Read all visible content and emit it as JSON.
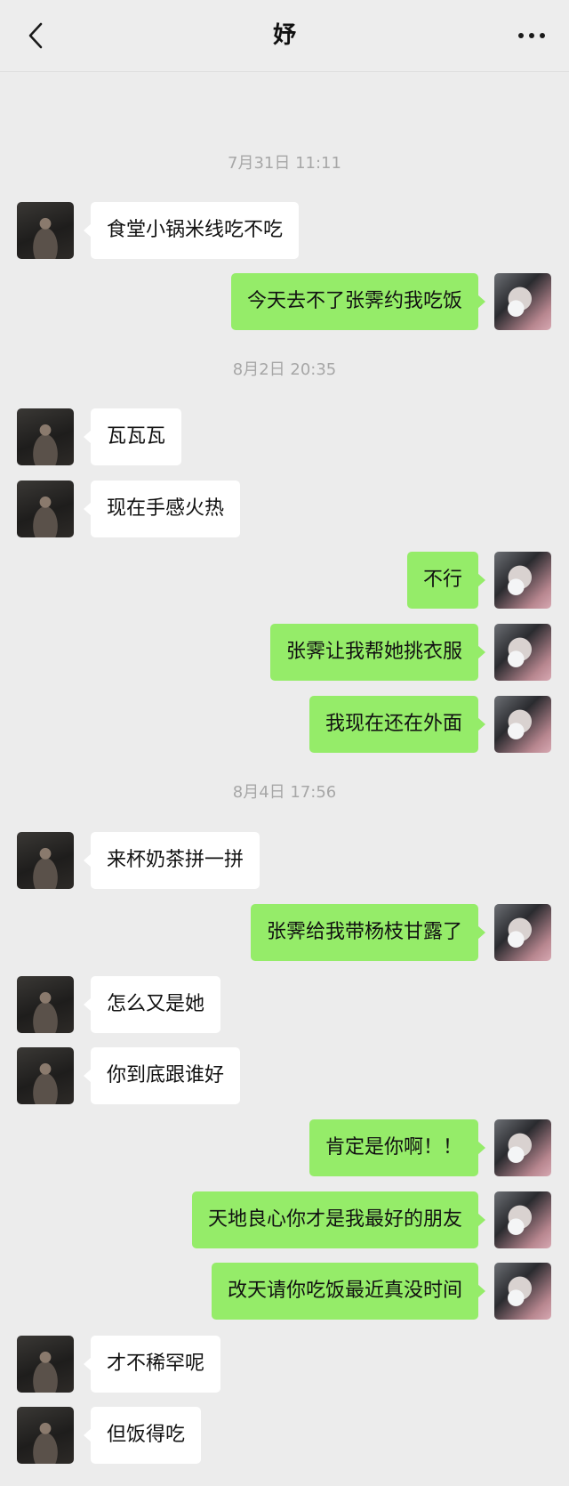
{
  "header": {
    "title": "妤",
    "back_icon": "chevron-left-icon",
    "more_icon": "more-dots-icon"
  },
  "colors": {
    "background": "#ececec",
    "sent_bubble": "#95ec69",
    "received_bubble": "#ffffff",
    "timestamp_text": "#a7a7a7"
  },
  "messages": [
    {
      "type": "time",
      "text": "7月31日 11:11"
    },
    {
      "type": "msg",
      "side": "left",
      "text": "食堂小锅米线吃不吃"
    },
    {
      "type": "msg",
      "side": "right",
      "text": "今天去不了张霁约我吃饭"
    },
    {
      "type": "time",
      "text": "8月2日 20:35"
    },
    {
      "type": "msg",
      "side": "left",
      "text": "瓦瓦瓦"
    },
    {
      "type": "msg",
      "side": "left",
      "text": "现在手感火热"
    },
    {
      "type": "msg",
      "side": "right",
      "text": "不行"
    },
    {
      "type": "msg",
      "side": "right",
      "text": "张霁让我帮她挑衣服"
    },
    {
      "type": "msg",
      "side": "right",
      "text": "我现在还在外面"
    },
    {
      "type": "time",
      "text": "8月4日 17:56"
    },
    {
      "type": "msg",
      "side": "left",
      "text": "来杯奶茶拼一拼"
    },
    {
      "type": "msg",
      "side": "right",
      "text": "张霁给我带杨枝甘露了"
    },
    {
      "type": "msg",
      "side": "left",
      "text": "怎么又是她"
    },
    {
      "type": "msg",
      "side": "left",
      "text": "你到底跟谁好"
    },
    {
      "type": "msg",
      "side": "right",
      "text": "肯定是你啊！！"
    },
    {
      "type": "msg",
      "side": "right",
      "text": "天地良心你才是我最好的朋友"
    },
    {
      "type": "msg",
      "side": "right",
      "text": "改天请你吃饭最近真没时间"
    },
    {
      "type": "msg",
      "side": "left",
      "text": "才不稀罕呢"
    },
    {
      "type": "msg",
      "side": "left",
      "text": "但饭得吃"
    }
  ]
}
